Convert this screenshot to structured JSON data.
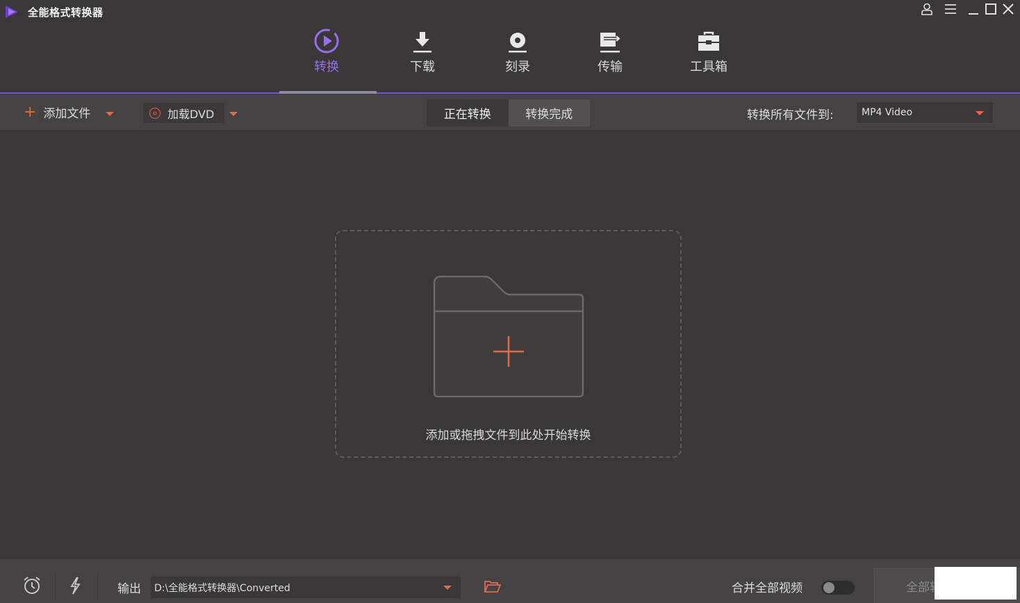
{
  "app": {
    "title": "全能格式转换器"
  },
  "window_controls": [
    "account-icon",
    "menu-icon",
    "minimize-icon",
    "maximize-icon",
    "close-icon"
  ],
  "nav": {
    "tabs": [
      {
        "label": "转换",
        "icon": "play-circle-icon",
        "active": true
      },
      {
        "label": "下载",
        "icon": "download-icon",
        "active": false
      },
      {
        "label": "刻录",
        "icon": "disc-icon",
        "active": false
      },
      {
        "label": "传输",
        "icon": "transfer-icon",
        "active": false
      },
      {
        "label": "工具箱",
        "icon": "toolbox-icon",
        "active": false
      }
    ]
  },
  "toolbar": {
    "add_file_label": "添加文件",
    "load_dvd_label": "加载DVD",
    "segments": [
      "正在转换",
      "转换完成"
    ],
    "active_segment": "正在转换",
    "convert_all_to_label": "转换所有文件到:",
    "output_format": "MP4 Video"
  },
  "main": {
    "drop_hint": "添加或拖拽文件到此处开始转换"
  },
  "footer": {
    "output_label": "输出",
    "output_path": "D:\\全能格式转换器\\Converted",
    "merge_label": "合并全部视频",
    "merge_enabled": false,
    "convert_all_label": "全部转换"
  },
  "colors": {
    "accent": "#9b6cf0",
    "orange": "#e8684a",
    "background": "#393737",
    "toolbar": "#444242"
  }
}
